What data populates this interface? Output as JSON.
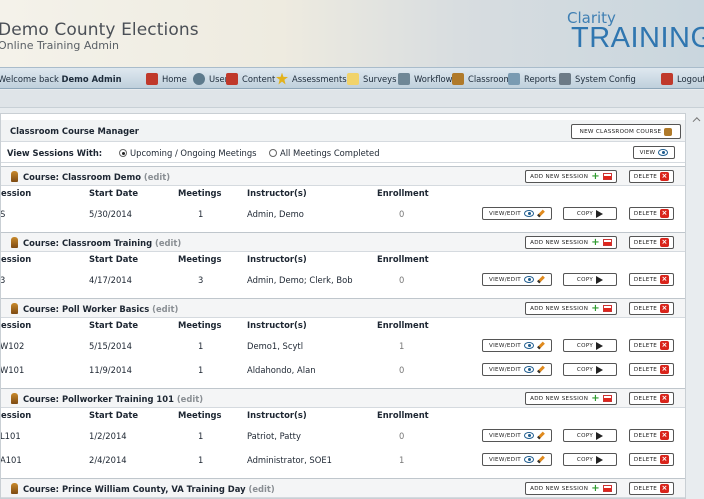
{
  "header": {
    "app_title": "Demo County Elections",
    "app_subtitle": "Online Training Admin",
    "brand_small": "Clarity",
    "brand_big": "TRAINING"
  },
  "nav": {
    "welcome_prefix": "Welcome back",
    "welcome_user": "Demo Admin",
    "items": [
      {
        "label": "Home",
        "icon": "home-icon",
        "color": "#c0392b"
      },
      {
        "label": "Users",
        "icon": "users-icon",
        "color": "#5d7a8c"
      },
      {
        "label": "Content",
        "icon": "content-icon",
        "color": "#c0392b"
      },
      {
        "label": "Assessments",
        "icon": "star-icon",
        "color": "#e3b21c"
      },
      {
        "label": "Surveys",
        "icon": "surveys-icon",
        "color": "#f1d36b"
      },
      {
        "label": "Workflow",
        "icon": "workflow-icon",
        "color": "#6f8796"
      },
      {
        "label": "Classroom",
        "icon": "classroom-icon",
        "color": "#b07a2a"
      },
      {
        "label": "Reports",
        "icon": "reports-icon",
        "color": "#7a9bb2"
      },
      {
        "label": "System Config",
        "icon": "config-icon",
        "color": "#6c7a86"
      },
      {
        "label": "Logout",
        "icon": "logout-icon",
        "color": "#c0392b"
      }
    ]
  },
  "manager": {
    "title": "Classroom Course Manager",
    "new_course_button": "NEW CLASSROOM COURSE",
    "view_sessions_label": "View Sessions With:",
    "radio_upcoming": "Upcoming / Ongoing Meetings",
    "radio_completed": "All Meetings Completed",
    "view_button": "VIEW"
  },
  "labels": {
    "course_prefix": "Course:",
    "edit": "(edit)",
    "add_session": "ADD NEW SESSION",
    "delete": "DELETE",
    "view_edit": "VIEW/EDIT",
    "copy": "COPY"
  },
  "columns": [
    "Session",
    "Start Date",
    "Meetings",
    "Instructor(s)",
    "Enrollment"
  ],
  "courses": [
    {
      "name": "Classroom Demo",
      "sessions": [
        {
          "session": "S",
          "start": "5/30/2014",
          "meetings": "1",
          "instructors": "Admin, Demo",
          "enrollment": "0"
        }
      ]
    },
    {
      "name": "Classroom Training",
      "sessions": [
        {
          "session": "3",
          "start": "4/17/2014",
          "meetings": "3",
          "instructors": "Admin, Demo; Clerk, Bob",
          "enrollment": "0"
        }
      ]
    },
    {
      "name": "Poll Worker Basics",
      "sessions": [
        {
          "session": "W102",
          "start": "5/15/2014",
          "meetings": "1",
          "instructors": "Demo1, Scytl",
          "enrollment": "1"
        },
        {
          "session": "W101",
          "start": "11/9/2014",
          "meetings": "1",
          "instructors": "Aldahondo, Alan",
          "enrollment": "0"
        }
      ]
    },
    {
      "name": "Pollworker Training 101",
      "sessions": [
        {
          "session": "L101",
          "start": "1/2/2014",
          "meetings": "1",
          "instructors": "Patriot, Patty",
          "enrollment": "0"
        },
        {
          "session": "A101",
          "start": "2/4/2014",
          "meetings": "1",
          "instructors": "Administrator, SOE1",
          "enrollment": "1"
        }
      ]
    },
    {
      "name": "Prince William County, VA Training Day",
      "sessions": []
    }
  ]
}
